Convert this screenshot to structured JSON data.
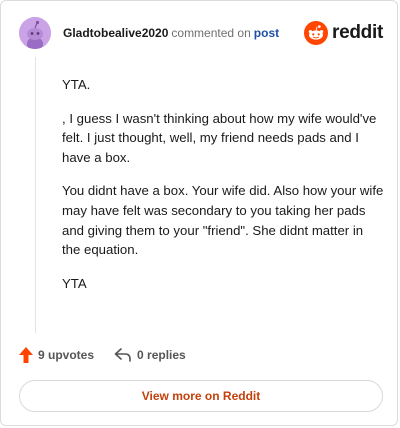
{
  "header": {
    "username": "Gladtobealive2020",
    "verb": "commented on",
    "post_link": "post",
    "brand_word": "reddit",
    "brand_color": "#ff4500"
  },
  "comment": {
    "paragraphs": [
      "YTA.",
      ", I guess I wasn't thinking about how my wife would've felt. I just thought, well, my friend needs pads and I have a box.",
      "You didnt have a box. Your wife did. Also how your wife may have felt was secondary to you taking her pads and giving them to your \"friend\". She didnt matter in the equation.",
      "YTA"
    ]
  },
  "actions": {
    "upvotes": "9 upvotes",
    "replies": "0 replies",
    "upvote_icon": "upvote-arrow-icon",
    "reply_icon": "reply-arrow-icon",
    "upvote_color": "#ff4500"
  },
  "footer": {
    "view_more": "View more on Reddit",
    "view_more_color": "#c2410c"
  }
}
